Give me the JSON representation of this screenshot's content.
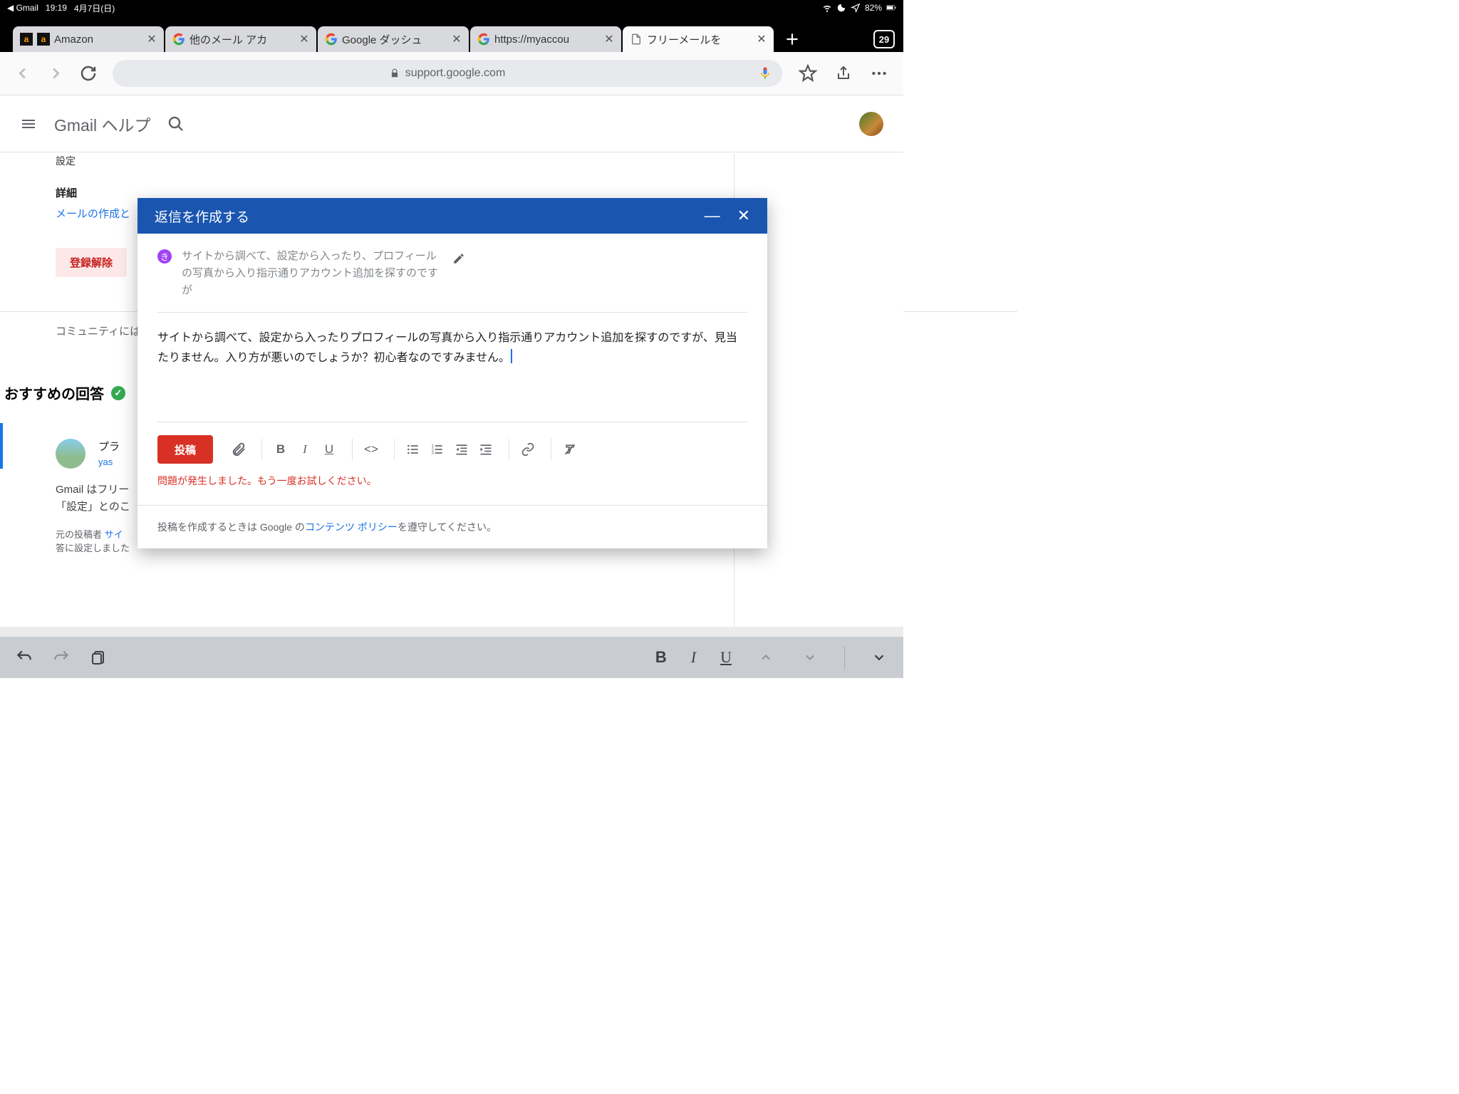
{
  "status_bar": {
    "back_app": "◀ Gmail",
    "time": "19:19",
    "date": "4月7日(日)",
    "battery": "82%"
  },
  "tabs": {
    "t0": "Amazon",
    "t1": "他のメール アカ",
    "t2": "Google ダッシュ",
    "t3": "https://myaccou",
    "t4": "フリーメールを",
    "count": "29"
  },
  "address_bar": {
    "host": "support.google.com"
  },
  "help": {
    "title": "Gmail ヘルプ",
    "settings_label": "設定",
    "details_label": "詳細",
    "compose_link": "メールの作成と",
    "unsubscribe": "登録解除",
    "community": "コミュニティには",
    "reco_title": "おすすめの回答",
    "answer_name": "プラ",
    "answer_user": "yas",
    "answer_body1": "Gmail はフリー",
    "answer_body2": "「設定」とのこ",
    "orig_label": "元の投稿者",
    "orig_link": "サイ",
    "orig_tail": "答に設定しました"
  },
  "modal": {
    "title": "返信を作成する",
    "badge": "き",
    "subject": "サイトから調べて、設定から入ったり、プロフィールの写真から入り指示通りアカウント追加を探すのですが",
    "body": "サイトから調べて、設定から入ったりプロフィールの写真から入り指示通りアカウント追加を探すのですが、見当たりません。入り方が悪いのでしょうか？初心者なのですみません。",
    "post": "投稿",
    "error": "問題が発生しました。もう一度お試しください。",
    "footer_a": "投稿を作成するときは Google の",
    "footer_link": "コンテンツ ポリシー",
    "footer_b": "を遵守してください。"
  }
}
